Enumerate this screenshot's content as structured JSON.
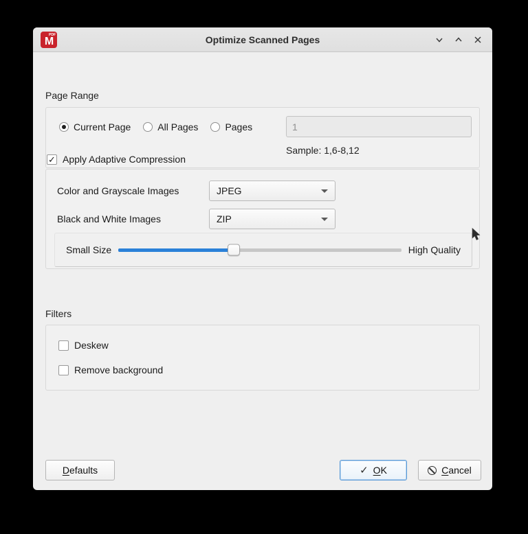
{
  "window": {
    "title": "Optimize Scanned Pages",
    "icon_letter": "M",
    "icon_badge": "PDF"
  },
  "icons": {
    "check": "✓"
  },
  "page_range": {
    "title": "Page Range",
    "radios": [
      {
        "label": "Current Page",
        "selected": true
      },
      {
        "label": "All Pages",
        "selected": false
      },
      {
        "label": "Pages",
        "selected": false
      }
    ],
    "input_value": "1",
    "sample": "Sample: 1,6-8,12"
  },
  "compression": {
    "checkbox_label": "Apply Adaptive Compression",
    "checked": true,
    "rows": [
      {
        "label": "Color and Grayscale Images",
        "value": "JPEG"
      },
      {
        "label": "Black and White Images",
        "value": "ZIP"
      }
    ],
    "slider": {
      "left_label": "Small Size",
      "right_label": "High Quality",
      "value_percent": 40.8
    }
  },
  "filters": {
    "title": "Filters",
    "items": [
      {
        "label": "Deskew",
        "checked": false
      },
      {
        "label": "Remove background",
        "checked": false
      }
    ]
  },
  "buttons": {
    "defaults": {
      "mnemonic": "D",
      "rest": "efaults"
    },
    "ok": {
      "mnemonic": "O",
      "rest": "K"
    },
    "cancel": {
      "mnemonic": "C",
      "rest": "ancel"
    }
  },
  "colors": {
    "accent_blue": "#2b81d8",
    "ok_border": "#5598d7",
    "icon_red": "#c9232b",
    "titlebar": "#e4e4e4",
    "dialog_bg": "#efefef"
  }
}
